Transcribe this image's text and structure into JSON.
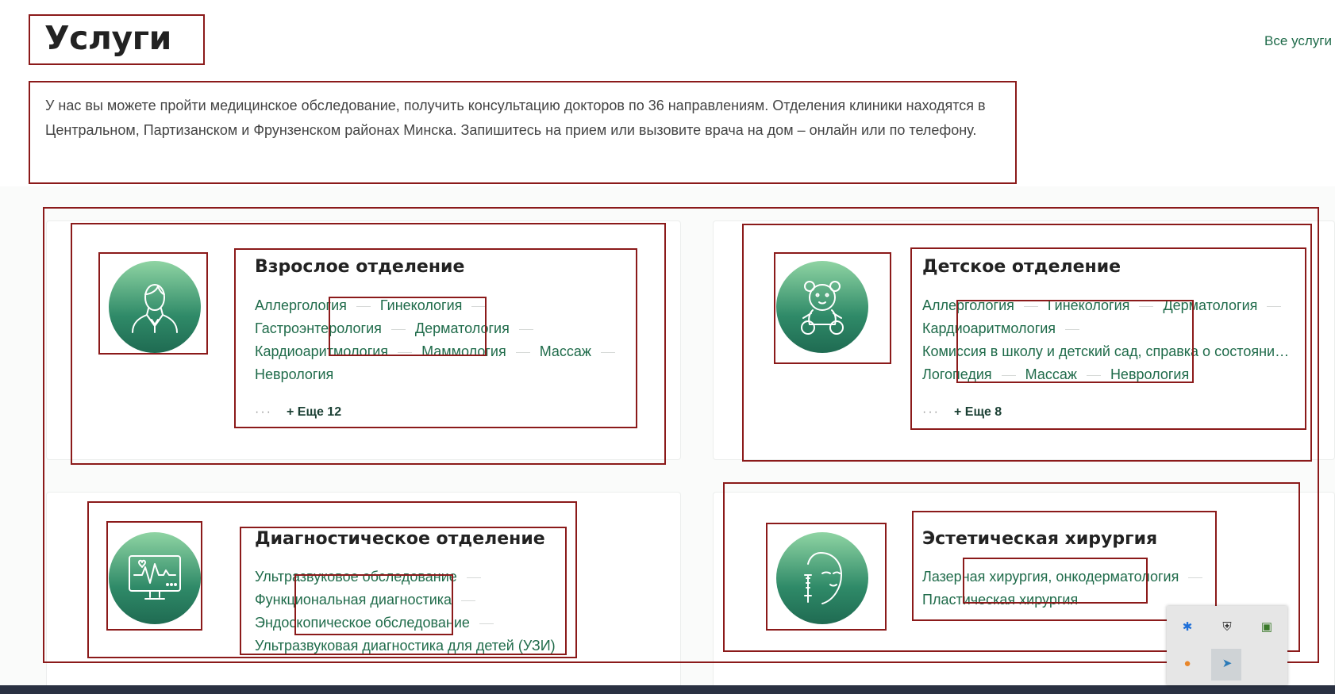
{
  "header": {
    "title": "Услуги",
    "all_services_link": "Все услуги",
    "intro": "У нас вы можете пройти медицинское обследование, получить консультацию докторов по 36 направлениям. Отделения клиники находятся в Центральном, Партизанском и Фрунзенском районах Минска. Запишитесь на прием или вызовите врача на дом – онлайн или по телефону."
  },
  "departments": [
    {
      "title": "Взрослое отделение",
      "icon": "adult-person-icon",
      "rows": [
        [
          "Аллергология",
          "Гинекология"
        ],
        [
          "Гастроэнтерология",
          "Дерматология"
        ],
        [
          "Кардиоаритмология",
          "Маммология",
          "Массаж"
        ],
        [
          "Неврология"
        ]
      ],
      "more": "+ Еще 12"
    },
    {
      "title": "Детское отделение",
      "icon": "teddy-bear-icon",
      "rows": [
        [
          "Аллергология",
          "Гинекология",
          "Дерматология"
        ],
        [
          "Кардиоаритмология"
        ],
        [
          "Комиссия в школу и детский сад, справка о состояни…"
        ],
        [
          "Логопедия",
          "Массаж",
          "Неврология"
        ]
      ],
      "more": "+ Еще 8"
    },
    {
      "title": "Диагностическое отделение",
      "icon": "monitor-ecg-icon",
      "rows": [
        [
          "Ультразвуковое обследование"
        ],
        [
          "Функциональная диагностика"
        ],
        [
          "Эндоскопическое обследование"
        ],
        [
          "Ультразвуковая диагностика для детей (УЗИ)"
        ]
      ],
      "more": ""
    },
    {
      "title": "Эстетическая хирургия",
      "icon": "face-syringe-icon",
      "rows": [
        [
          "Лазерная хирургия, онкодерматология"
        ],
        [
          "Пластическая хирургия"
        ]
      ],
      "more": ""
    }
  ],
  "colors": {
    "accent": "#1f6b4a",
    "box_outline": "#8b1a1a"
  },
  "tray_icons": [
    "bluetooth-icon",
    "security-shield-icon",
    "nvidia-icon",
    "app-orange-icon",
    "arrow-app-icon"
  ]
}
